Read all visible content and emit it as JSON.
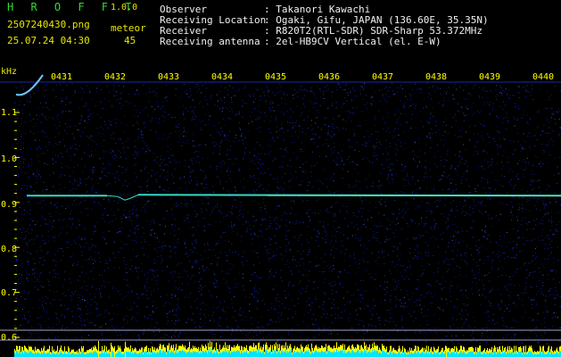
{
  "header": {
    "app_name": "H R O F F T",
    "version": "1.0.0",
    "file_name": "2507240430.png",
    "datetime": "25.07.24 04:30",
    "mode_label": "meteor",
    "count": "45"
  },
  "info": {
    "observer_label": "Observer",
    "observer_value": ": Takanori Kawachi",
    "location_label": "Receiving Location",
    "location_value": ": Ogaki, Gifu, JAPAN (136.60E, 35.35N)",
    "receiver_label": "Receiver",
    "receiver_value": ": R820T2(RTL-SDR) SDR-Sharp 53.372MHz",
    "antenna_label": "Receiving antenna",
    "antenna_value": ": 2el-HB9CV Vertical (el. E-W)"
  },
  "axis": {
    "unit": "kHz",
    "y_labels": [
      "1.1",
      "1.0",
      "0.9",
      "0.8",
      "0.7",
      "0.6"
    ],
    "time_ticks": [
      "0431",
      "0432",
      "0433",
      "0434",
      "0435",
      "0436",
      "0437",
      "0438",
      "0439",
      "0440"
    ]
  },
  "colors": {
    "background": "#000000",
    "noise": "#0a1a8c",
    "carrier": "#38d8c8",
    "meteor": "#6ec8ff",
    "meter_cyan": "#00e6ff",
    "meter_yellow": "#ffff00",
    "tick_yellow": "#ffff00"
  },
  "signals": {
    "carrier_frequency_khz": 0.915,
    "meteor_trail_start_khz": 1.14,
    "meteor_trail_end_khz": 1.22
  }
}
